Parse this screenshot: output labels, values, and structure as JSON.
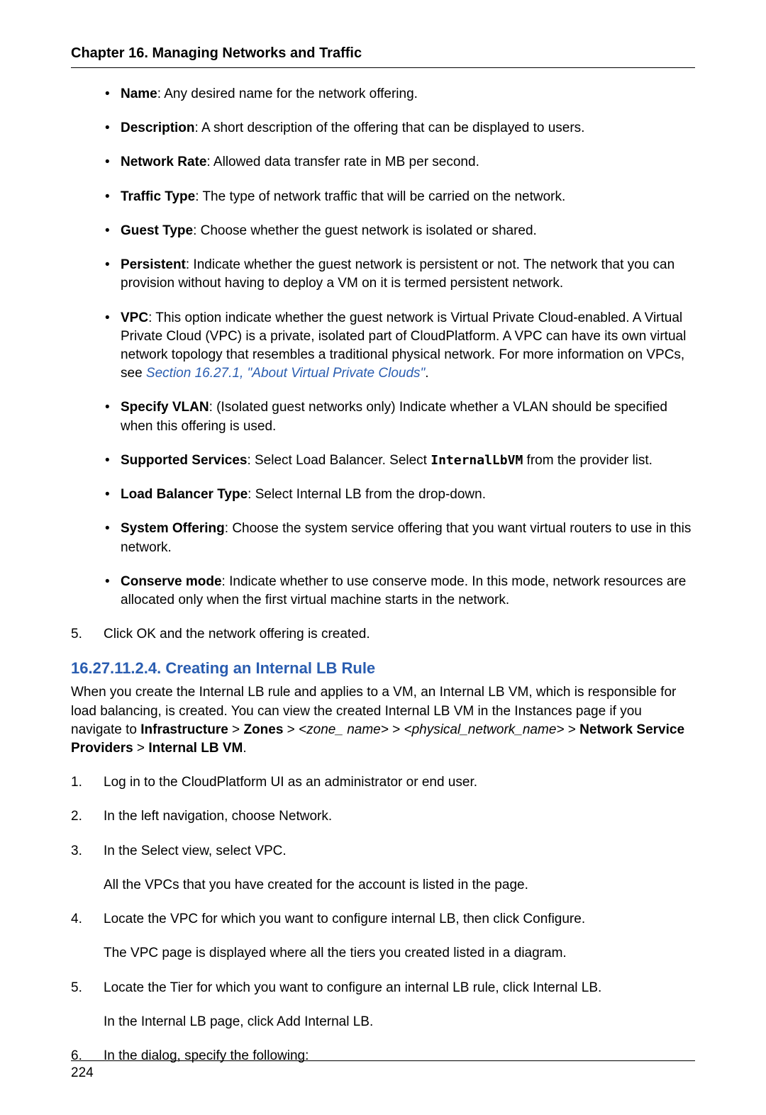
{
  "header": {
    "chapter_title": "Chapter 16. Managing Networks and Traffic"
  },
  "bullets": [
    {
      "term": "Name",
      "rest": ": Any desired name for the network offering."
    },
    {
      "term": "Description",
      "rest": ": A short description of the offering that can be displayed to users."
    },
    {
      "term": "Network Rate",
      "rest": ": Allowed data transfer rate in MB per second."
    },
    {
      "term": "Traffic Type",
      "rest": ": The type of network traffic that will be carried on the network."
    },
    {
      "term": "Guest Type",
      "rest": ": Choose whether the guest network is isolated or shared."
    },
    {
      "term": "Persistent",
      "rest": ": Indicate whether the guest network is persistent or not. The network that you can provision without having to deploy a VM on it is termed persistent network."
    },
    {
      "term": "VPC",
      "rest_before_link": ": This option indicate whether the guest network is Virtual Private Cloud-enabled. A Virtual Private Cloud (VPC) is a private, isolated part of CloudPlatform. A VPC can have its own virtual network topology that resembles a traditional physical network. For more information on VPCs, see ",
      "link": "Section 16.27.1, \"About Virtual Private Clouds\"",
      "after_link": "."
    },
    {
      "term": "Specify VLAN",
      "rest": ": (Isolated guest networks only) Indicate whether a VLAN should be specified when this offering is used."
    },
    {
      "term": "Supported Services",
      "rest_before_mono": ": Select Load Balancer. Select ",
      "mono": "InternalLbVM",
      "after_mono": " from the provider list."
    },
    {
      "term": "Load Balancer Type",
      "rest": ": Select Internal LB from the drop-down."
    },
    {
      "term": "System Offering",
      "rest": ": Choose the system service offering that you want virtual routers to use in this network."
    },
    {
      "term": "Conserve mode",
      "rest": ": Indicate whether to use conserve mode. In this mode, network resources are allocated only when the first virtual machine starts in the network."
    }
  ],
  "numbered_top": [
    "Click OK and the network offering is created."
  ],
  "section_heading": "16.27.11.2.4. Creating an Internal LB Rule",
  "intro_a": "When you create the Internal LB rule and applies to a VM, an Internal LB VM, which is responsible for load balancing, is created. You can view the created Internal LB VM in the Instances page if you navigate to ",
  "intro_b_bold_infra": "Infrastructure",
  "intro_gt1": " > ",
  "intro_b_bold_zones": "Zones",
  "intro_gt2": " > ",
  "intro_zone_it": "<zone_ name>",
  "intro_gt3": " > ",
  "intro_phys_it": "<physical_network_name>",
  "intro_gt4": " > ",
  "intro_b_bold_net": "Network Service Providers",
  "intro_gt5": " > ",
  "intro_b_bold_lb": "Internal LB VM",
  "intro_end": ".",
  "steps": [
    {
      "text": "Log in to the CloudPlatform UI as an administrator or end user."
    },
    {
      "text": "In the left navigation, choose Network."
    },
    {
      "text": "In the Select view, select VPC.",
      "sub": "All the VPCs that you have created for the account is listed in the page."
    },
    {
      "text": "Locate the VPC for which you want to configure internal LB, then click Configure.",
      "sub": "The VPC page is displayed where all the tiers you created listed in a diagram."
    },
    {
      "text": "Locate the Tier for which you want to configure an internal LB rule, click Internal LB.",
      "sub": "In the Internal LB page, click Add Internal LB."
    },
    {
      "text": "In the dialog, specify the following:"
    }
  ],
  "footer": {
    "page_number": "224"
  }
}
